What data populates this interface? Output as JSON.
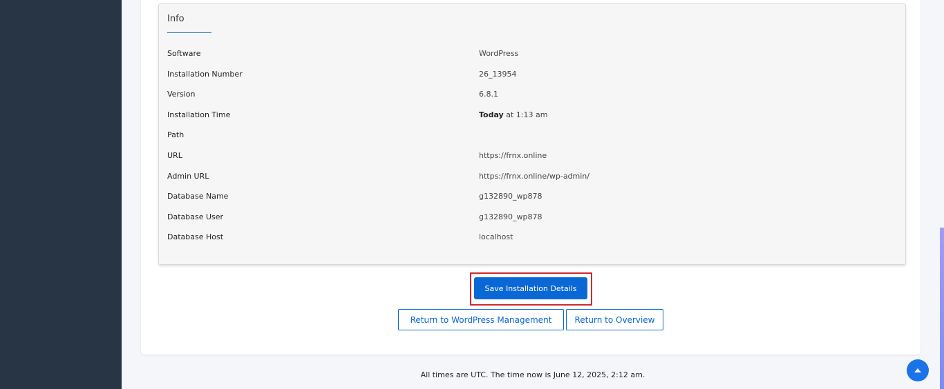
{
  "info": {
    "title": "Info",
    "rows": [
      {
        "label": "Software",
        "value": "WordPress"
      },
      {
        "label": "Installation Number",
        "value": "26_13954"
      },
      {
        "label": "Version",
        "value": "6.8.1"
      },
      {
        "label": "Installation Time",
        "value_bold": "Today",
        "value": " at 1:13 am"
      },
      {
        "label": "Path",
        "value": ""
      },
      {
        "label": "URL",
        "value": "https://frnx.online"
      },
      {
        "label": "Admin URL",
        "value": "https://frnx.online/wp-admin/"
      },
      {
        "label": "Database Name",
        "value": "g132890_wp878"
      },
      {
        "label": "Database User",
        "value": "g132890_wp878"
      },
      {
        "label": "Database Host",
        "value": "localhost"
      }
    ]
  },
  "buttons": {
    "save": "Save Installation Details",
    "return_wp": "Return to WordPress Management",
    "return_overview": "Return to Overview"
  },
  "footer": {
    "text": "All times are UTC. The time now is June 12, 2025, 2:12 am."
  },
  "icons": {
    "scroll_top": "caret-up-icon"
  },
  "colors": {
    "sidebar": "#273545",
    "primary": "#0a68d6",
    "highlight": "#d0282e"
  }
}
